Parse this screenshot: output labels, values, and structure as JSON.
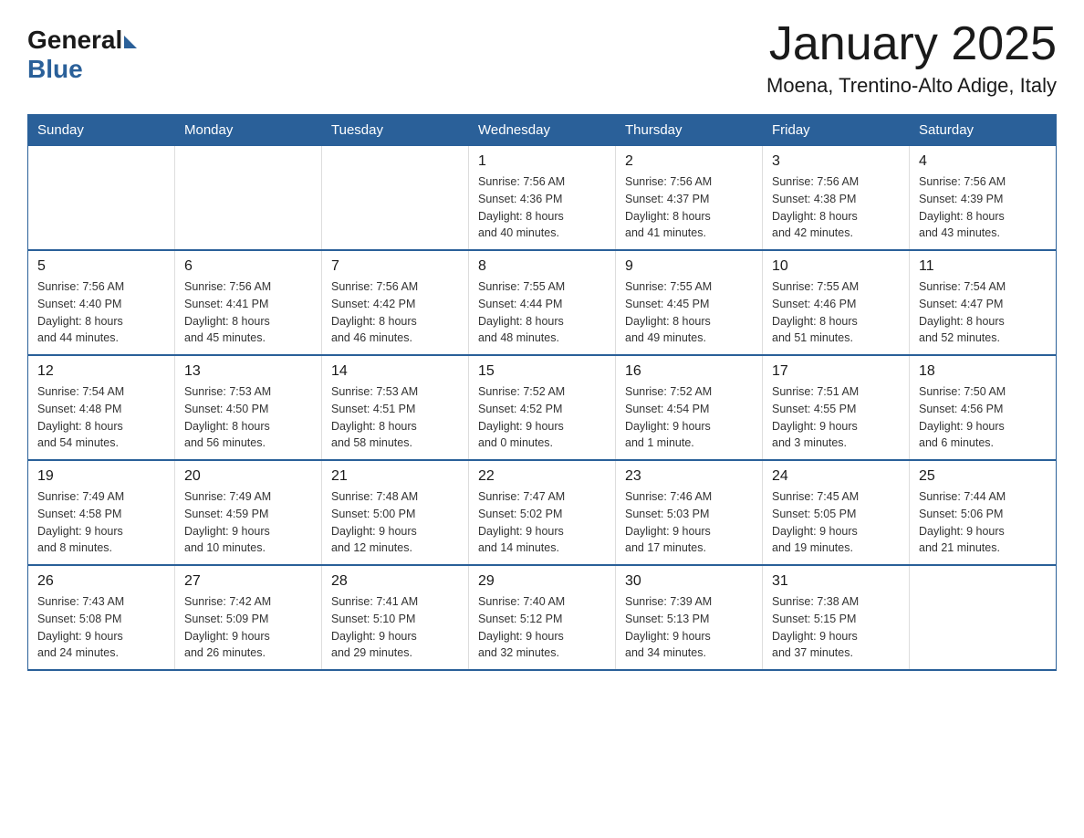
{
  "header": {
    "logo_general": "General",
    "logo_blue": "Blue",
    "title": "January 2025",
    "subtitle": "Moena, Trentino-Alto Adige, Italy"
  },
  "days_of_week": [
    "Sunday",
    "Monday",
    "Tuesday",
    "Wednesday",
    "Thursday",
    "Friday",
    "Saturday"
  ],
  "weeks": [
    [
      {
        "day": "",
        "info": ""
      },
      {
        "day": "",
        "info": ""
      },
      {
        "day": "",
        "info": ""
      },
      {
        "day": "1",
        "info": "Sunrise: 7:56 AM\nSunset: 4:36 PM\nDaylight: 8 hours\nand 40 minutes."
      },
      {
        "day": "2",
        "info": "Sunrise: 7:56 AM\nSunset: 4:37 PM\nDaylight: 8 hours\nand 41 minutes."
      },
      {
        "day": "3",
        "info": "Sunrise: 7:56 AM\nSunset: 4:38 PM\nDaylight: 8 hours\nand 42 minutes."
      },
      {
        "day": "4",
        "info": "Sunrise: 7:56 AM\nSunset: 4:39 PM\nDaylight: 8 hours\nand 43 minutes."
      }
    ],
    [
      {
        "day": "5",
        "info": "Sunrise: 7:56 AM\nSunset: 4:40 PM\nDaylight: 8 hours\nand 44 minutes."
      },
      {
        "day": "6",
        "info": "Sunrise: 7:56 AM\nSunset: 4:41 PM\nDaylight: 8 hours\nand 45 minutes."
      },
      {
        "day": "7",
        "info": "Sunrise: 7:56 AM\nSunset: 4:42 PM\nDaylight: 8 hours\nand 46 minutes."
      },
      {
        "day": "8",
        "info": "Sunrise: 7:55 AM\nSunset: 4:44 PM\nDaylight: 8 hours\nand 48 minutes."
      },
      {
        "day": "9",
        "info": "Sunrise: 7:55 AM\nSunset: 4:45 PM\nDaylight: 8 hours\nand 49 minutes."
      },
      {
        "day": "10",
        "info": "Sunrise: 7:55 AM\nSunset: 4:46 PM\nDaylight: 8 hours\nand 51 minutes."
      },
      {
        "day": "11",
        "info": "Sunrise: 7:54 AM\nSunset: 4:47 PM\nDaylight: 8 hours\nand 52 minutes."
      }
    ],
    [
      {
        "day": "12",
        "info": "Sunrise: 7:54 AM\nSunset: 4:48 PM\nDaylight: 8 hours\nand 54 minutes."
      },
      {
        "day": "13",
        "info": "Sunrise: 7:53 AM\nSunset: 4:50 PM\nDaylight: 8 hours\nand 56 minutes."
      },
      {
        "day": "14",
        "info": "Sunrise: 7:53 AM\nSunset: 4:51 PM\nDaylight: 8 hours\nand 58 minutes."
      },
      {
        "day": "15",
        "info": "Sunrise: 7:52 AM\nSunset: 4:52 PM\nDaylight: 9 hours\nand 0 minutes."
      },
      {
        "day": "16",
        "info": "Sunrise: 7:52 AM\nSunset: 4:54 PM\nDaylight: 9 hours\nand 1 minute."
      },
      {
        "day": "17",
        "info": "Sunrise: 7:51 AM\nSunset: 4:55 PM\nDaylight: 9 hours\nand 3 minutes."
      },
      {
        "day": "18",
        "info": "Sunrise: 7:50 AM\nSunset: 4:56 PM\nDaylight: 9 hours\nand 6 minutes."
      }
    ],
    [
      {
        "day": "19",
        "info": "Sunrise: 7:49 AM\nSunset: 4:58 PM\nDaylight: 9 hours\nand 8 minutes."
      },
      {
        "day": "20",
        "info": "Sunrise: 7:49 AM\nSunset: 4:59 PM\nDaylight: 9 hours\nand 10 minutes."
      },
      {
        "day": "21",
        "info": "Sunrise: 7:48 AM\nSunset: 5:00 PM\nDaylight: 9 hours\nand 12 minutes."
      },
      {
        "day": "22",
        "info": "Sunrise: 7:47 AM\nSunset: 5:02 PM\nDaylight: 9 hours\nand 14 minutes."
      },
      {
        "day": "23",
        "info": "Sunrise: 7:46 AM\nSunset: 5:03 PM\nDaylight: 9 hours\nand 17 minutes."
      },
      {
        "day": "24",
        "info": "Sunrise: 7:45 AM\nSunset: 5:05 PM\nDaylight: 9 hours\nand 19 minutes."
      },
      {
        "day": "25",
        "info": "Sunrise: 7:44 AM\nSunset: 5:06 PM\nDaylight: 9 hours\nand 21 minutes."
      }
    ],
    [
      {
        "day": "26",
        "info": "Sunrise: 7:43 AM\nSunset: 5:08 PM\nDaylight: 9 hours\nand 24 minutes."
      },
      {
        "day": "27",
        "info": "Sunrise: 7:42 AM\nSunset: 5:09 PM\nDaylight: 9 hours\nand 26 minutes."
      },
      {
        "day": "28",
        "info": "Sunrise: 7:41 AM\nSunset: 5:10 PM\nDaylight: 9 hours\nand 29 minutes."
      },
      {
        "day": "29",
        "info": "Sunrise: 7:40 AM\nSunset: 5:12 PM\nDaylight: 9 hours\nand 32 minutes."
      },
      {
        "day": "30",
        "info": "Sunrise: 7:39 AM\nSunset: 5:13 PM\nDaylight: 9 hours\nand 34 minutes."
      },
      {
        "day": "31",
        "info": "Sunrise: 7:38 AM\nSunset: 5:15 PM\nDaylight: 9 hours\nand 37 minutes."
      },
      {
        "day": "",
        "info": ""
      }
    ]
  ]
}
